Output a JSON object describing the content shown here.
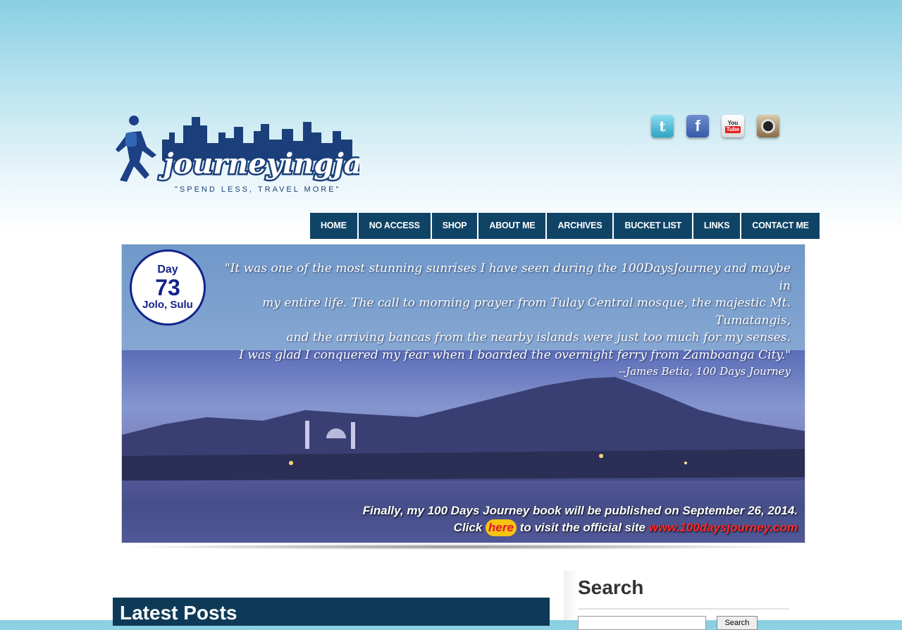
{
  "header": {
    "logo_text": "journeyingjames",
    "tagline": "\"SPEND LESS, TRAVEL MORE\""
  },
  "social": [
    {
      "name": "twitter",
      "icon": "twitter-icon"
    },
    {
      "name": "facebook",
      "icon": "facebook-icon"
    },
    {
      "name": "youtube",
      "icon": "youtube-icon",
      "text_top": "You",
      "text_bottom": "Tube"
    },
    {
      "name": "instagram",
      "icon": "instagram-icon"
    }
  ],
  "nav": [
    "HOME",
    "NO ACCESS",
    "SHOP",
    "ABOUT ME",
    "ARCHIVES",
    "BUCKET LIST",
    "LINKS",
    "CONTACT ME"
  ],
  "banner": {
    "badge": {
      "day": "Day",
      "number": "73",
      "place": "Jolo, Sulu"
    },
    "quote_lines": [
      "\"It was one of the most stunning sunrises I have seen during the 100DaysJourney and maybe in",
      "my entire life. The call to morning prayer from Tulay Central mosque, the majestic Mt. Tumatangis,",
      "and the arriving bancas from the nearby islands were just too much for my senses.",
      "I was glad I conquered my fear when I boarded the overnight ferry from Zamboanga City.\""
    ],
    "attribution": "--James Betia, 100 Days Journey",
    "promo_line1": "Finally, my 100 Days Journey book will be published on September 26, 2014.",
    "promo_click": "Click",
    "promo_here": "here",
    "promo_middle": "to visit the official site",
    "promo_site": "www.100daysjourney.com"
  },
  "main": {
    "section_title": "Latest Posts"
  },
  "sidebar": {
    "search_title": "Search",
    "search_button": "Search"
  },
  "colors": {
    "nav_bg": "#0f4466",
    "brand_blue": "#12238a",
    "section_bar": "#0f3a57"
  }
}
